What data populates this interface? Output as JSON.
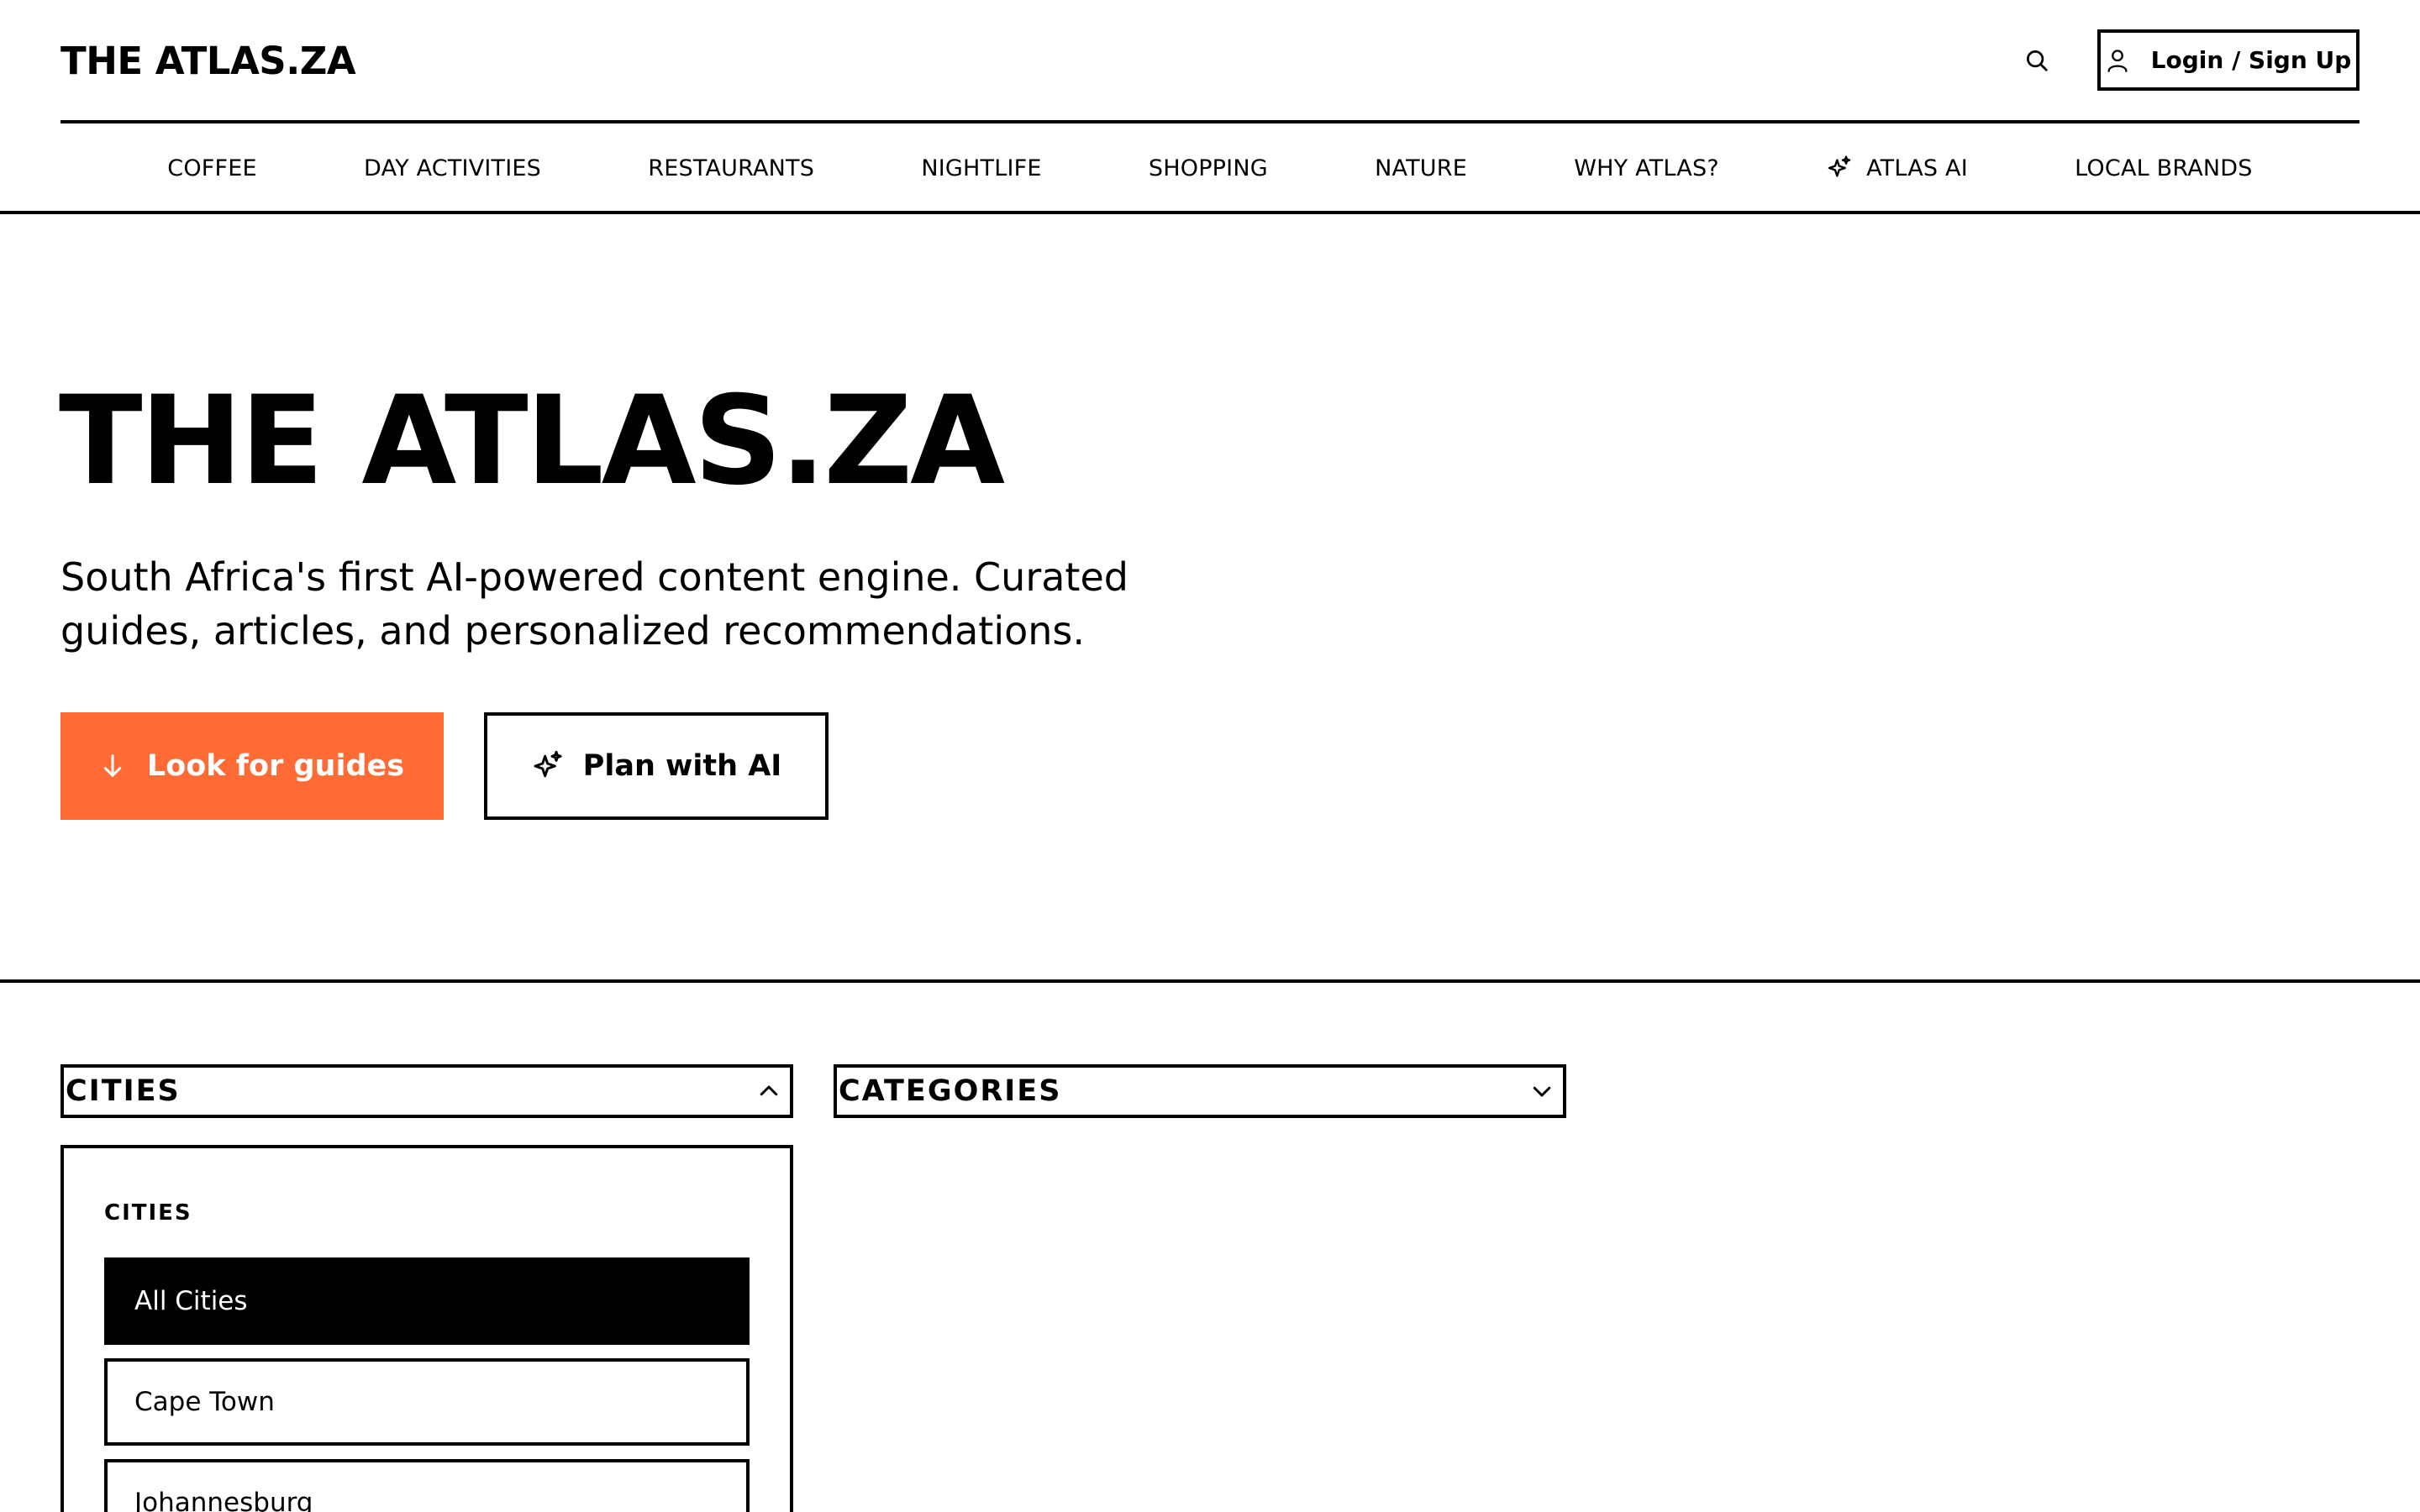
{
  "header": {
    "logo": "THE ATLAS.ZA",
    "login_label": "Login / Sign Up"
  },
  "nav": {
    "items": [
      {
        "label": "COFFEE"
      },
      {
        "label": "DAY ACTIVITIES"
      },
      {
        "label": "RESTAURANTS"
      },
      {
        "label": "NIGHTLIFE"
      },
      {
        "label": "SHOPPING"
      },
      {
        "label": "NATURE"
      },
      {
        "label": "WHY ATLAS?"
      },
      {
        "label": "ATLAS AI",
        "icon": "sparkle-icon"
      },
      {
        "label": "LOCAL BRANDS"
      }
    ]
  },
  "hero": {
    "title": "THE ATLAS.ZA",
    "subtitle": "South Africa's first AI-powered content engine. Curated guides, articles, and personalized recommendations.",
    "primary_button": "Look for guides",
    "secondary_button": "Plan with AI"
  },
  "filters": {
    "cities_label": "CITIES",
    "categories_label": "CATEGORIES",
    "cities_panel": {
      "heading": "CITIES",
      "options": [
        {
          "label": "All Cities",
          "selected": true
        },
        {
          "label": "Cape Town",
          "selected": false
        },
        {
          "label": "Johannesburg",
          "selected": false
        }
      ]
    }
  },
  "colors": {
    "accent": "#ff6b35",
    "text": "#000000",
    "background": "#ffffff"
  }
}
